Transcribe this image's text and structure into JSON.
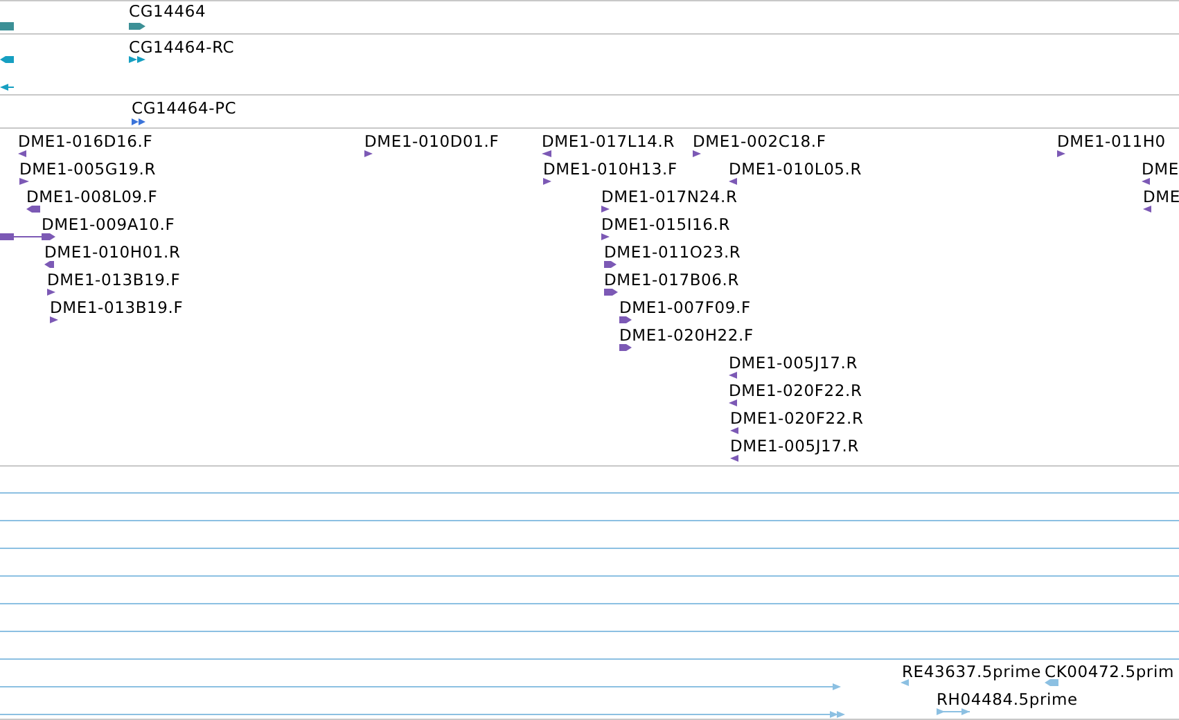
{
  "tracks": [
    {
      "kind": "gene",
      "features": [
        {
          "kind": "bar"
        },
        {
          "label": "CG14464",
          "kind": "block",
          "reverse": false
        }
      ]
    },
    {
      "kind": "transcript",
      "features": [
        {
          "kind": "block",
          "reverse": true
        },
        {
          "label": "CG14464-RC",
          "kind": "double-arrow",
          "reverse": false
        },
        {
          "kind": "arrow-line",
          "reverse": true
        }
      ]
    },
    {
      "kind": "protein",
      "features": [
        {
          "label": "CG14464-PC",
          "kind": "double-arrow",
          "reverse": false
        }
      ]
    },
    {
      "kind": "est",
      "features": [
        {
          "label": "DME1-016D16.F",
          "kind": "arrow",
          "reverse": true
        },
        {
          "label": "DME1-005G19.R",
          "kind": "arrow",
          "reverse": false
        },
        {
          "label": "DME1-008L09.F",
          "kind": "block",
          "reverse": true
        },
        {
          "kind": "line-block",
          "reverse": true
        },
        {
          "label": "DME1-009A10.F",
          "kind": "block",
          "reverse": false
        },
        {
          "label": "DME1-010H01.R",
          "kind": "block",
          "reverse": true
        },
        {
          "label": "DME1-013B19.F",
          "kind": "arrow",
          "reverse": false
        },
        {
          "label": "DME1-013B19.F",
          "kind": "arrow",
          "reverse": false
        },
        {
          "label": "DME1-010D01.F",
          "kind": "arrow",
          "reverse": false
        },
        {
          "label": "DME1-017L14.R",
          "kind": "arrow",
          "reverse": true
        },
        {
          "label": "DME1-002C18.F",
          "kind": "arrow",
          "reverse": false
        },
        {
          "label": "DME1-010H13.F",
          "kind": "arrow",
          "reverse": false
        },
        {
          "label": "DME1-010L05.R",
          "kind": "arrow",
          "reverse": true
        },
        {
          "label": "DME1-017N24.R",
          "kind": "arrow",
          "reverse": false
        },
        {
          "label": "DME1-015I16.R",
          "kind": "arrow",
          "reverse": false
        },
        {
          "label": "DME1-011O23.R",
          "kind": "block",
          "reverse": false
        },
        {
          "label": "DME1-017B06.R",
          "kind": "block",
          "reverse": false
        },
        {
          "label": "DME1-007F09.F",
          "kind": "block",
          "reverse": false
        },
        {
          "label": "DME1-020H22.F",
          "kind": "block",
          "reverse": false
        },
        {
          "label": "DME1-005J17.R",
          "kind": "arrow",
          "reverse": true
        },
        {
          "label": "DME1-020F22.R",
          "kind": "arrow",
          "reverse": true
        },
        {
          "label": "DME1-020F22.R",
          "kind": "arrow",
          "reverse": true
        },
        {
          "label": "DME1-005J17.R",
          "kind": "arrow",
          "reverse": true
        },
        {
          "label": "DME1-011H0",
          "kind": "arrow",
          "reverse": false
        },
        {
          "label": "DME",
          "kind": "arrow",
          "reverse": true
        },
        {
          "label": "DME",
          "kind": "arrow",
          "reverse": true
        }
      ]
    },
    {
      "kind": "cdna",
      "features": [
        {
          "kind": "span"
        },
        {
          "kind": "span"
        },
        {
          "kind": "span"
        },
        {
          "kind": "span"
        },
        {
          "kind": "span"
        },
        {
          "kind": "span"
        },
        {
          "kind": "span"
        },
        {
          "kind": "arrow-line",
          "reverse": false
        },
        {
          "kind": "double-arrow-line",
          "reverse": false
        },
        {
          "label": "RE43637.5prime",
          "kind": "arrow",
          "reverse": true
        },
        {
          "label": "CK00472.5prim",
          "kind": "block",
          "reverse": true
        },
        {
          "label": "RH04484.5prime",
          "kind": "arrow-span",
          "reverse": false
        }
      ]
    }
  ]
}
